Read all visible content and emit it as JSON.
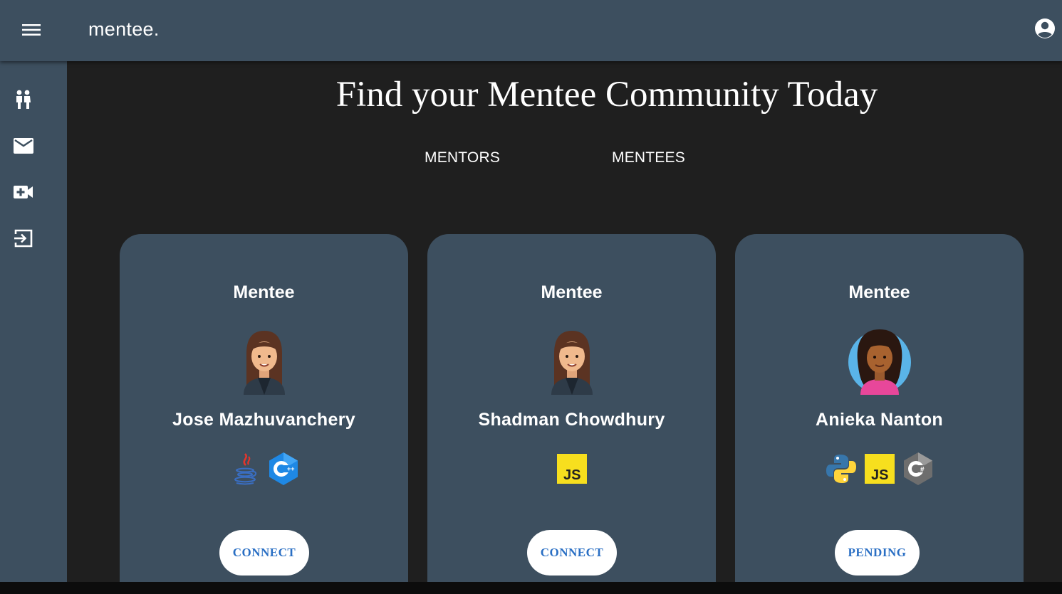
{
  "appbar": {
    "brand": "mentee."
  },
  "sidebar": {
    "items": [
      {
        "icon": "people-icon"
      },
      {
        "icon": "mail-icon"
      },
      {
        "icon": "video-call-icon"
      },
      {
        "icon": "logout-icon"
      }
    ]
  },
  "main": {
    "title": "Find your Mentee Community Today",
    "tabs": [
      {
        "label": "MENTORS"
      },
      {
        "label": "MENTEES"
      }
    ],
    "cards": [
      {
        "role": "Mentee",
        "name": "Jose Mazhuvanchery",
        "skills": [
          "java-icon",
          "cpp-icon"
        ],
        "button": "CONNECT"
      },
      {
        "role": "Mentee",
        "name": "Shadman Chowdhury",
        "skills": [
          "javascript-icon"
        ],
        "button": "CONNECT"
      },
      {
        "role": "Mentee",
        "name": "Anieka Nanton",
        "skills": [
          "python-icon",
          "javascript-icon",
          "csharp-icon"
        ],
        "button": "PENDING"
      }
    ]
  },
  "colors": {
    "appbar": "#3d4f5f",
    "background": "#1f1f1f",
    "card": "#3d4f5f",
    "button_text": "#2a6fc4"
  }
}
